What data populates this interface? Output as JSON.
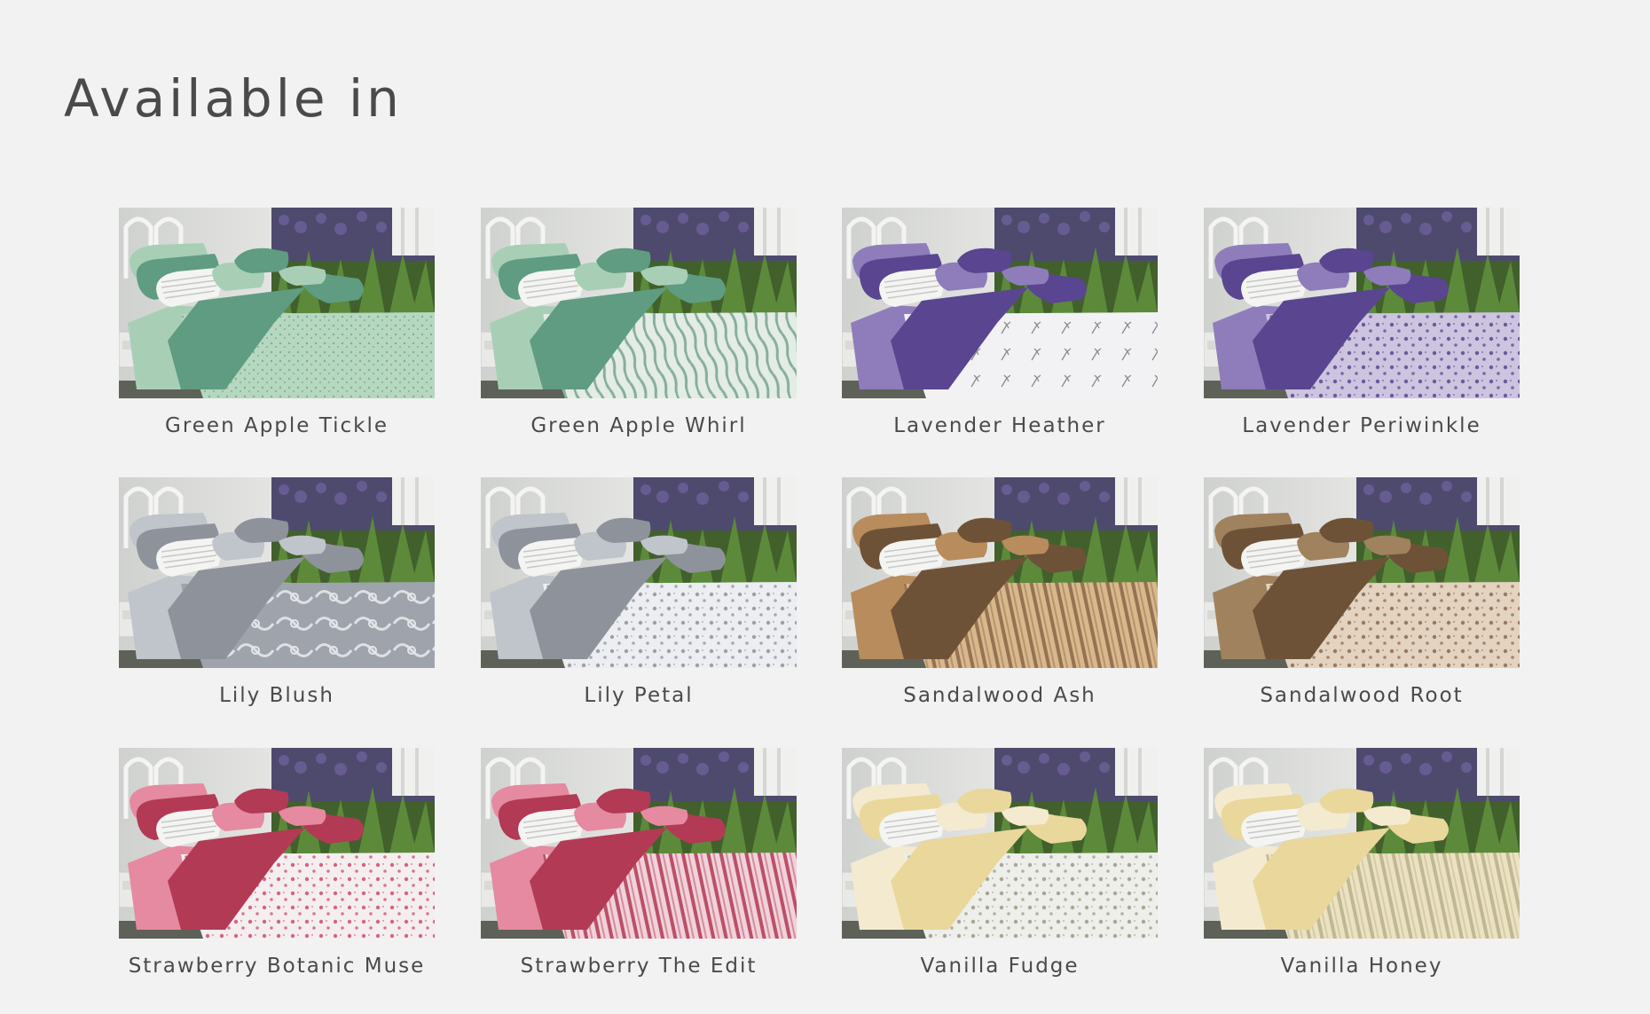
{
  "page": {
    "title": "Available in"
  },
  "products": [
    {
      "name": "Green Apple Tickle",
      "pattern": "speckle",
      "colors": {
        "accent": "#5f9c82",
        "light": "#a8cfb6",
        "base": "#b6d7c0",
        "motif": "#7fb192"
      }
    },
    {
      "name": "Green Apple Whirl",
      "pattern": "whirl",
      "colors": {
        "accent": "#5f9c82",
        "light": "#a8cfb6",
        "base": "#e4ece6",
        "motif": "#6f9f88"
      }
    },
    {
      "name": "Lavender Heather",
      "pattern": "sprig",
      "colors": {
        "accent": "#5a4590",
        "light": "#8f7dbb",
        "base": "#f2f2f4",
        "motif": "#8a8a92"
      }
    },
    {
      "name": "Lavender Periwinkle",
      "pattern": "floral",
      "colors": {
        "accent": "#5a4590",
        "light": "#8f7dbb",
        "base": "#cdc4e0",
        "motif": "#5a4590"
      }
    },
    {
      "name": "Lily Blush",
      "pattern": "ribbon",
      "colors": {
        "accent": "#8e929b",
        "light": "#c0c4cb",
        "base": "#9ea3ac",
        "motif": "#e6e7ea"
      }
    },
    {
      "name": "Lily Petal",
      "pattern": "floral",
      "colors": {
        "accent": "#8e929b",
        "light": "#c0c4cb",
        "base": "#eceef1",
        "motif": "#8e929b"
      }
    },
    {
      "name": "Sandalwood Ash",
      "pattern": "stripes",
      "colors": {
        "accent": "#6e5238",
        "light": "#b88c5c",
        "base": "#d8b88c",
        "motif": "#8a6848"
      }
    },
    {
      "name": "Sandalwood Root",
      "pattern": "floral",
      "colors": {
        "accent": "#6e5238",
        "light": "#a0825e",
        "base": "#e3d3c0",
        "motif": "#8a6a50"
      }
    },
    {
      "name": "Strawberry Botanic Muse",
      "pattern": "floral",
      "colors": {
        "accent": "#b23a55",
        "light": "#e58aa0",
        "base": "#f5eef0",
        "motif": "#c8506a"
      }
    },
    {
      "name": "Strawberry The Edit",
      "pattern": "stripes",
      "colors": {
        "accent": "#b23a55",
        "light": "#e58aa0",
        "base": "#f1d2da",
        "motif": "#b23a55"
      }
    },
    {
      "name": "Vanilla Fudge",
      "pattern": "floral",
      "colors": {
        "accent": "#e9d79c",
        "light": "#f4ead0",
        "base": "#eeeeea",
        "motif": "#9a9a88"
      }
    },
    {
      "name": "Vanilla Honey",
      "pattern": "stripes",
      "colors": {
        "accent": "#e9d79c",
        "light": "#f4ead0",
        "base": "#ece2c2",
        "motif": "#b8b08c"
      }
    }
  ]
}
